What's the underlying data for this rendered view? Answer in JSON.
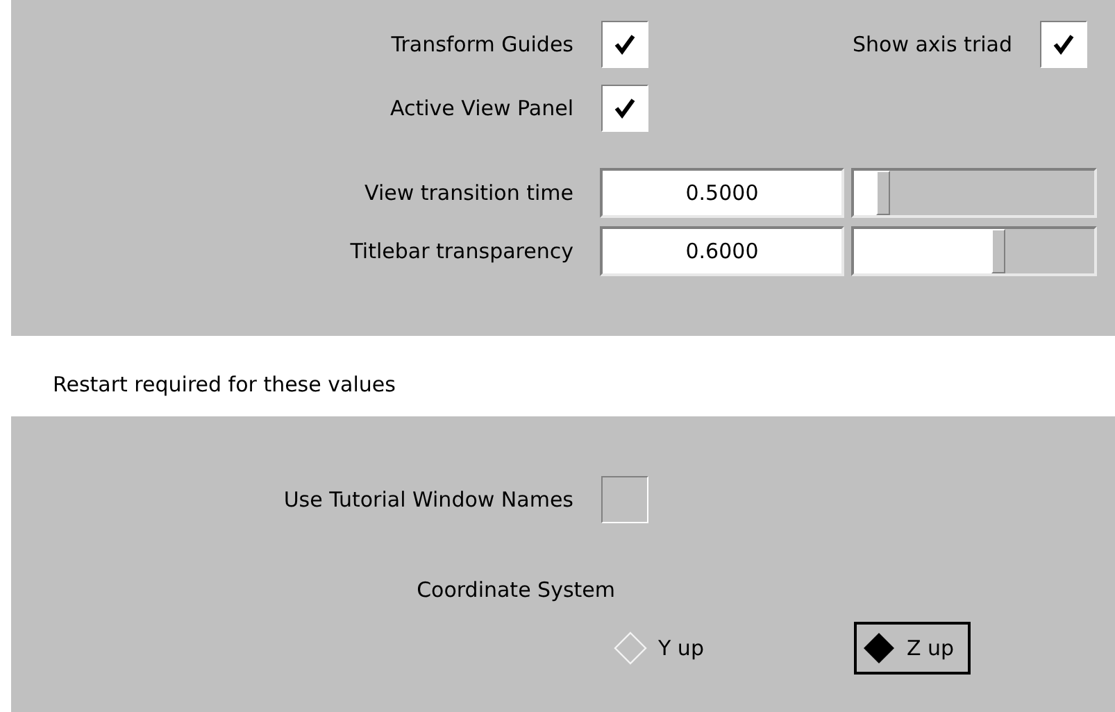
{
  "checks": [
    {
      "label": "Transform Guides",
      "checked": true
    },
    {
      "label": "Show axis triad",
      "checked": true
    },
    {
      "label": "Active View Panel",
      "checked": true
    }
  ],
  "sliders": [
    {
      "label": "View transition time",
      "value": "0.5000",
      "level": 0.12
    },
    {
      "label": "Titlebar transparency",
      "value": "0.6000",
      "level": 0.6
    }
  ],
  "restart_note": "Restart required for these values",
  "restart": {
    "tutorial": {
      "label": "Use Tutorial Window Names",
      "checked": false
    },
    "coordinate_label": "Coordinate System",
    "options": [
      {
        "label": "Y up",
        "selected": false
      },
      {
        "label": "Z up",
        "selected": true
      }
    ]
  }
}
